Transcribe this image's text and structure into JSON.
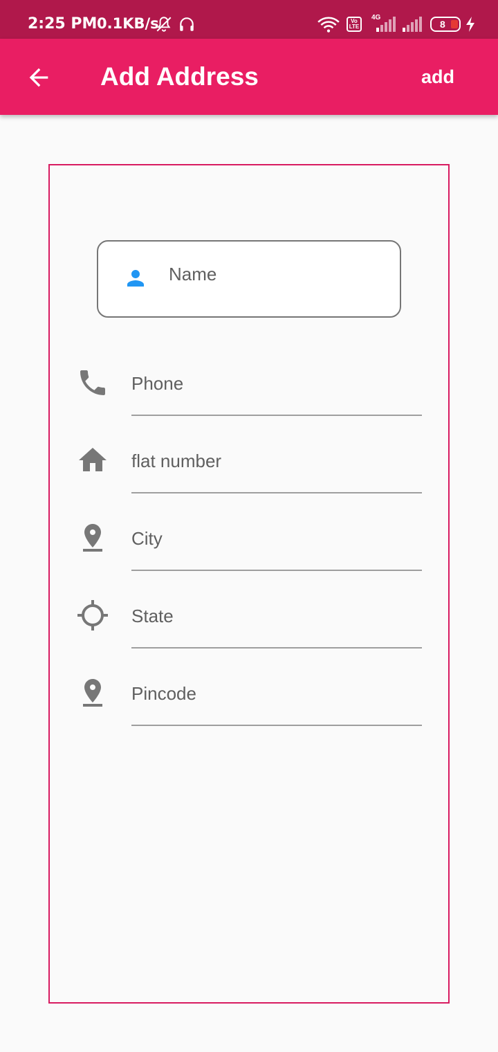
{
  "status_bar": {
    "time": "2:25 PM",
    "speed": "0.1KB/s",
    "network_type": "4G",
    "volte": "Vo LTE",
    "battery": "8",
    "icons": [
      "mute-bell-icon",
      "headphones-icon",
      "wifi-icon",
      "volte-icon",
      "signal-icon",
      "signal-icon",
      "battery-icon",
      "charging-icon"
    ]
  },
  "app_bar": {
    "title": "Add Address",
    "action_label": "add",
    "back_icon": "arrow-back-icon",
    "background": "#e91e63"
  },
  "form": {
    "name": {
      "placeholder": "Name",
      "value": "",
      "icon": "person-icon",
      "icon_color": "#2196f3"
    },
    "phone": {
      "placeholder": "Phone",
      "value": "",
      "icon": "phone-icon"
    },
    "flat": {
      "placeholder": "flat number",
      "value": "",
      "icon": "home-icon"
    },
    "city": {
      "placeholder": "City",
      "value": "",
      "icon": "location-pin-icon"
    },
    "state": {
      "placeholder": "State",
      "value": "",
      "icon": "gps-target-icon"
    },
    "pincode": {
      "placeholder": "Pincode",
      "value": "",
      "icon": "location-pin-icon"
    }
  },
  "colors": {
    "status_bar": "#b0184b",
    "card_border": "#d81b60",
    "field_icon": "#777777",
    "underline": "#9e9e9e"
  }
}
